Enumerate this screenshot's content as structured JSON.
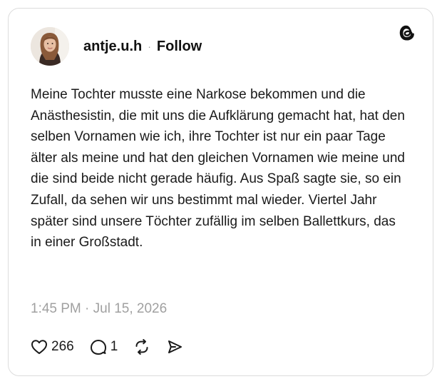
{
  "author": {
    "username": "antje.u.h",
    "separator": "·",
    "follow_label": "Follow",
    "avatar_icon": "profile-photo"
  },
  "post": {
    "text": "Meine Tochter musste eine Narkose bekommen und die Anästhesistin, die mit uns die Aufklärung gemacht hat, hat den selben Vornamen wie ich, ihre Tochter ist nur ein paar Tage älter als meine und hat den gleichen Vornamen wie meine und die sind beide nicht gerade häufig. Aus Spaß sagte sie, so ein Zufall, da sehen wir uns bestimmt mal wieder. Viertel Jahr später sind unsere Töchter zufällig im selben Ballettkurs, das in einer Großstadt.",
    "timestamp": "1:45 PM · Jul 15, 2026"
  },
  "actions": {
    "like_icon": "heart-icon",
    "like_count": "266",
    "reply_icon": "speech-bubble-icon",
    "reply_count": "1",
    "repost_icon": "repost-icon",
    "share_icon": "send-icon"
  },
  "branding": {
    "logo_icon": "threads-logo",
    "text_color": "#111111",
    "muted_color": "#a0a0a0",
    "border_color": "#dcdcdc"
  }
}
